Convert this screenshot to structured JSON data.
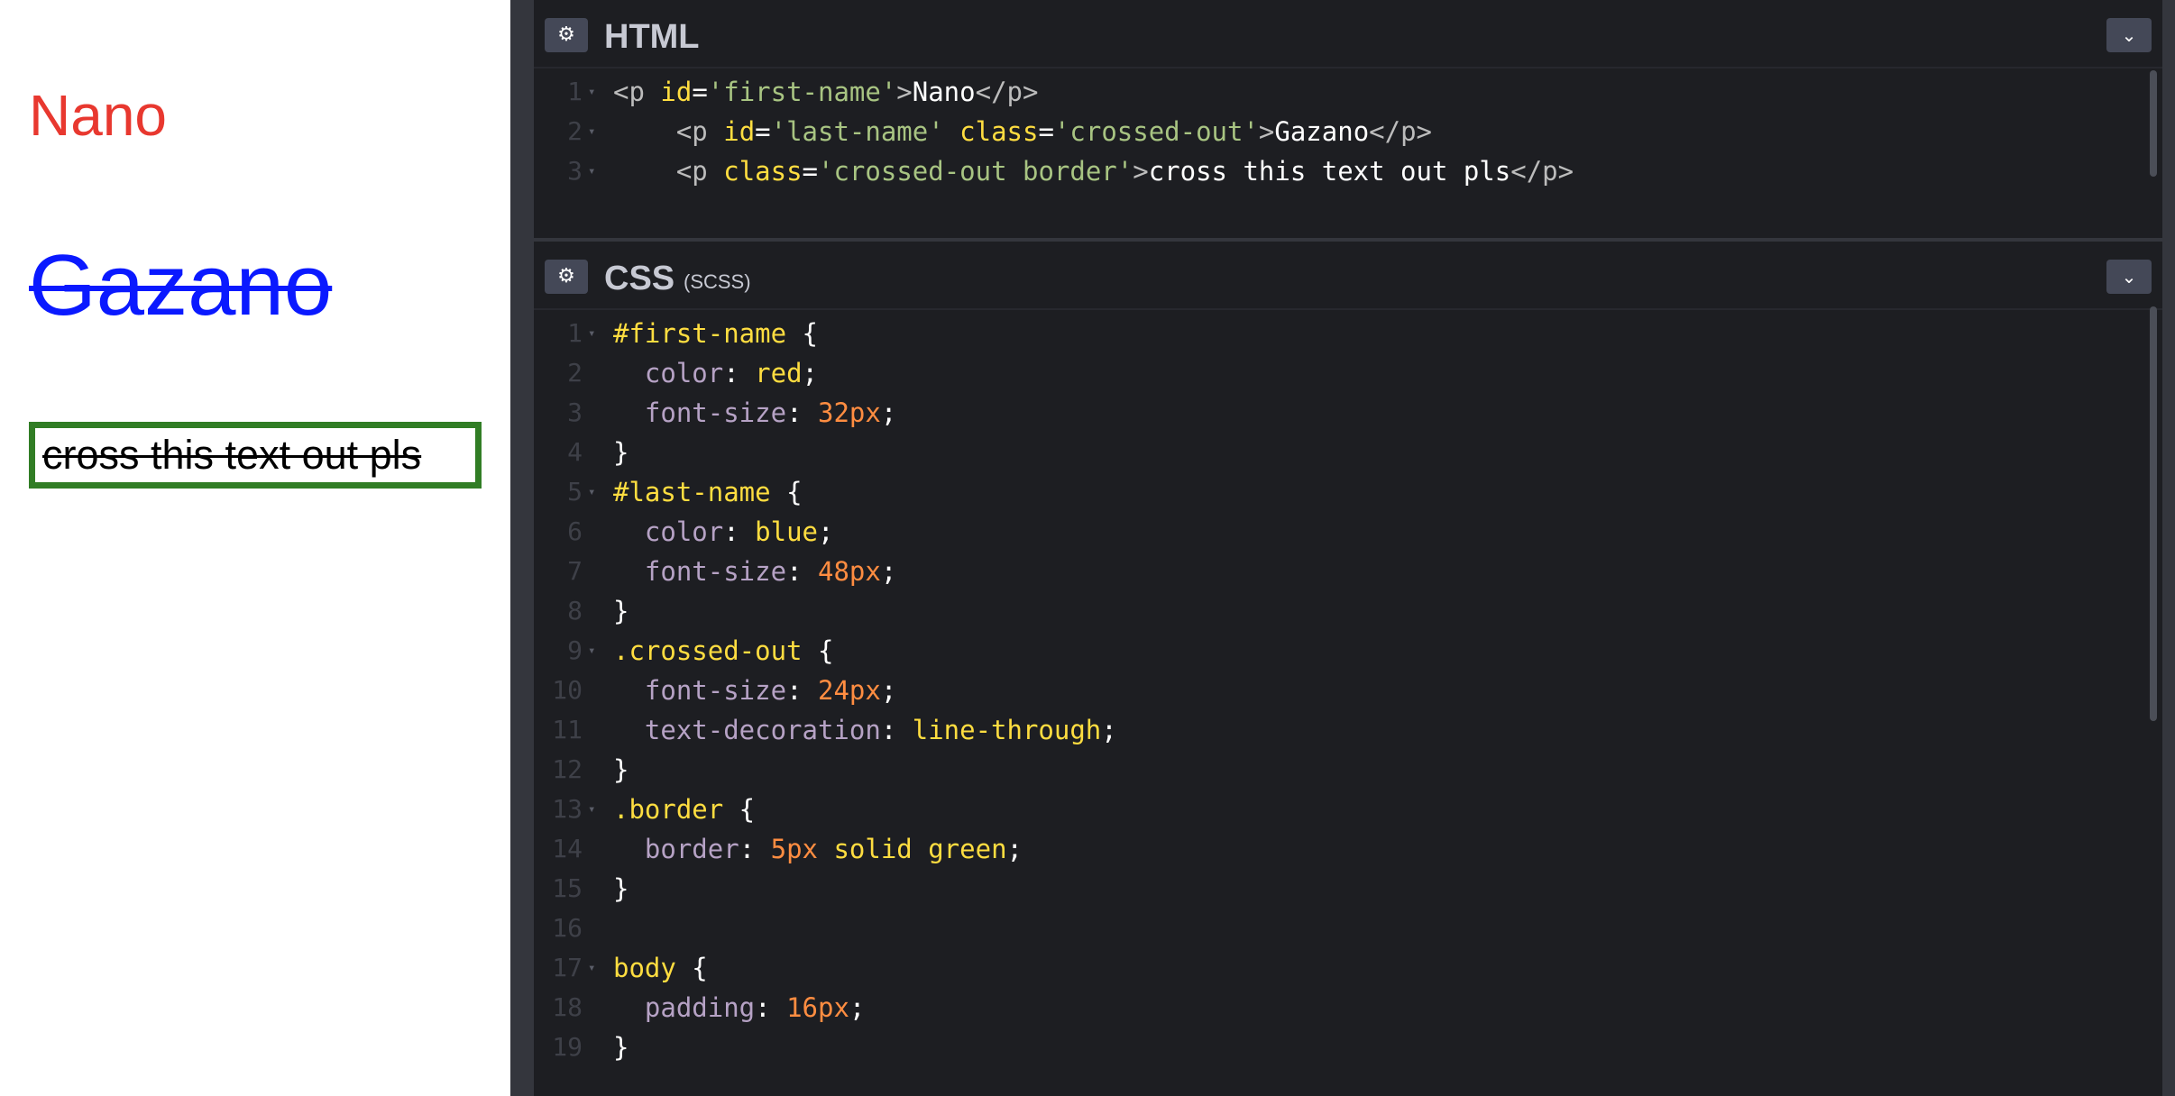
{
  "preview": {
    "first_name": "Nano",
    "last_name": "Gazano",
    "crossed_text": "cross this text out pls",
    "colors": {
      "first": "#e8382f",
      "last": "#0a19ff",
      "crossed_text": "#000000",
      "border": "#317d25"
    }
  },
  "html_panel": {
    "gear_icon": "⚙",
    "title": "HTML",
    "collapse_icon": "⌄",
    "lines": [
      {
        "num": "1",
        "tokens": [
          {
            "t": "tag",
            "v": "<p "
          },
          {
            "t": "attr",
            "v": "id"
          },
          {
            "t": "punc",
            "v": "="
          },
          {
            "t": "str",
            "v": "'first-name'"
          },
          {
            "t": "tag",
            "v": ">"
          },
          {
            "t": "text",
            "v": "Nano"
          },
          {
            "t": "tag",
            "v": "</p>"
          }
        ]
      },
      {
        "num": "2",
        "tokens": [
          {
            "t": "text",
            "v": "    "
          },
          {
            "t": "tag",
            "v": "<p "
          },
          {
            "t": "attr",
            "v": "id"
          },
          {
            "t": "punc",
            "v": "="
          },
          {
            "t": "str",
            "v": "'last-name'"
          },
          {
            "t": "text",
            "v": " "
          },
          {
            "t": "attr",
            "v": "class"
          },
          {
            "t": "punc",
            "v": "="
          },
          {
            "t": "str",
            "v": "'crossed-out'"
          },
          {
            "t": "tag",
            "v": ">"
          },
          {
            "t": "text",
            "v": "Gazano"
          },
          {
            "t": "tag",
            "v": "</p>"
          }
        ]
      },
      {
        "num": "3",
        "tokens": [
          {
            "t": "text",
            "v": "    "
          },
          {
            "t": "tag",
            "v": "<p "
          },
          {
            "t": "attr",
            "v": "class"
          },
          {
            "t": "punc",
            "v": "="
          },
          {
            "t": "str",
            "v": "'crossed-out border'"
          },
          {
            "t": "tag",
            "v": ">"
          },
          {
            "t": "text",
            "v": "cross this text out pls"
          },
          {
            "t": "tag",
            "v": "</p>"
          }
        ]
      }
    ]
  },
  "css_panel": {
    "gear_icon": "⚙",
    "title": "CSS",
    "subtitle": "(SCSS)",
    "collapse_icon": "⌄",
    "lines": [
      {
        "num": "1",
        "tokens": [
          {
            "t": "sel",
            "v": "#first-name"
          },
          {
            "t": "punc",
            "v": " {"
          }
        ]
      },
      {
        "num": "2",
        "tokens": [
          {
            "t": "text",
            "v": "  "
          },
          {
            "t": "prop",
            "v": "color"
          },
          {
            "t": "punc",
            "v": ": "
          },
          {
            "t": "val",
            "v": "red"
          },
          {
            "t": "punc",
            "v": ";"
          }
        ]
      },
      {
        "num": "3",
        "tokens": [
          {
            "t": "text",
            "v": "  "
          },
          {
            "t": "prop",
            "v": "font-size"
          },
          {
            "t": "punc",
            "v": ": "
          },
          {
            "t": "num",
            "v": "32px"
          },
          {
            "t": "punc",
            "v": ";"
          }
        ]
      },
      {
        "num": "4",
        "tokens": [
          {
            "t": "punc",
            "v": "}"
          }
        ]
      },
      {
        "num": "5",
        "tokens": [
          {
            "t": "sel",
            "v": "#last-name"
          },
          {
            "t": "punc",
            "v": " {"
          }
        ]
      },
      {
        "num": "6",
        "tokens": [
          {
            "t": "text",
            "v": "  "
          },
          {
            "t": "prop",
            "v": "color"
          },
          {
            "t": "punc",
            "v": ": "
          },
          {
            "t": "val",
            "v": "blue"
          },
          {
            "t": "punc",
            "v": ";"
          }
        ]
      },
      {
        "num": "7",
        "tokens": [
          {
            "t": "text",
            "v": "  "
          },
          {
            "t": "prop",
            "v": "font-size"
          },
          {
            "t": "punc",
            "v": ": "
          },
          {
            "t": "num",
            "v": "48px"
          },
          {
            "t": "punc",
            "v": ";"
          }
        ]
      },
      {
        "num": "8",
        "tokens": [
          {
            "t": "punc",
            "v": "}"
          }
        ]
      },
      {
        "num": "9",
        "tokens": [
          {
            "t": "sel",
            "v": ".crossed-out"
          },
          {
            "t": "punc",
            "v": " {"
          }
        ]
      },
      {
        "num": "10",
        "tokens": [
          {
            "t": "text",
            "v": "  "
          },
          {
            "t": "prop",
            "v": "font-size"
          },
          {
            "t": "punc",
            "v": ": "
          },
          {
            "t": "num",
            "v": "24px"
          },
          {
            "t": "punc",
            "v": ";"
          }
        ]
      },
      {
        "num": "11",
        "tokens": [
          {
            "t": "text",
            "v": "  "
          },
          {
            "t": "prop",
            "v": "text-decoration"
          },
          {
            "t": "punc",
            "v": ": "
          },
          {
            "t": "val",
            "v": "line-through"
          },
          {
            "t": "punc",
            "v": ";"
          }
        ]
      },
      {
        "num": "12",
        "tokens": [
          {
            "t": "punc",
            "v": "}"
          }
        ]
      },
      {
        "num": "13",
        "tokens": [
          {
            "t": "sel",
            "v": ".border"
          },
          {
            "t": "punc",
            "v": " {"
          }
        ]
      },
      {
        "num": "14",
        "tokens": [
          {
            "t": "text",
            "v": "  "
          },
          {
            "t": "prop",
            "v": "border"
          },
          {
            "t": "punc",
            "v": ": "
          },
          {
            "t": "num",
            "v": "5px"
          },
          {
            "t": "text",
            "v": " "
          },
          {
            "t": "val",
            "v": "solid green"
          },
          {
            "t": "punc",
            "v": ";"
          }
        ]
      },
      {
        "num": "15",
        "tokens": [
          {
            "t": "punc",
            "v": "}"
          }
        ]
      },
      {
        "num": "16",
        "tokens": []
      },
      {
        "num": "17",
        "tokens": [
          {
            "t": "sel",
            "v": "body"
          },
          {
            "t": "punc",
            "v": " {"
          }
        ]
      },
      {
        "num": "18",
        "tokens": [
          {
            "t": "text",
            "v": "  "
          },
          {
            "t": "prop",
            "v": "padding"
          },
          {
            "t": "punc",
            "v": ": "
          },
          {
            "t": "num",
            "v": "16px"
          },
          {
            "t": "punc",
            "v": ";"
          }
        ]
      },
      {
        "num": "19",
        "tokens": [
          {
            "t": "punc",
            "v": "}"
          }
        ]
      }
    ]
  }
}
